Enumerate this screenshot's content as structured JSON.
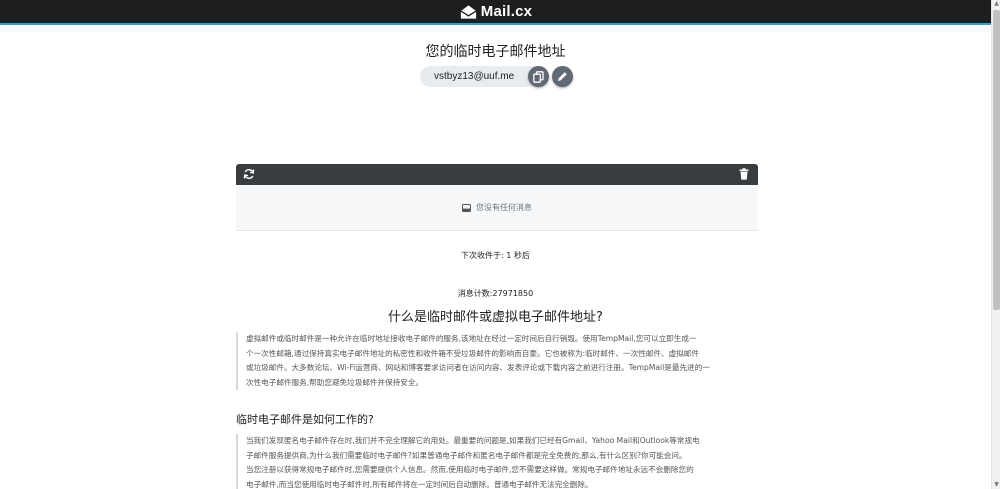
{
  "header": {
    "logo_text": "Mail.cx"
  },
  "address": {
    "title": "您的临时电子邮件地址",
    "email": "vstbyz13@uuf.me"
  },
  "inbox": {
    "empty_text": "您没有任何消息",
    "next_label": "下次收件于:",
    "next_value": "1",
    "next_unit": "秒后"
  },
  "stats": {
    "message_count": "消息计数:27971850"
  },
  "article": {
    "title": "什么是临时邮件或虚拟电子邮件地址?",
    "paragraph_lines": [
      "虚拟邮件或临时邮件是一种允许在临时地址接收电子邮件的服务,该地址在经过一定时间后自行销毁。使用TempMail,您可以立即生成一",
      "个一次性邮箱,通过保持真实电子邮件地址的私密性和收件箱不受垃圾邮件的影响而自豪。它也被称为:临时邮件、一次性邮件、虚拟邮件",
      "或垃圾邮件。大多数论坛、Wi-Fi运营商、网站和博客要求访问者在访问内容、发表评论或下载内容之前进行注册。TempMail是最先进的一",
      "次性电子邮件服务,帮助您避免垃圾邮件并保持安全。"
    ],
    "section_title": "临时电子邮件是如何工作的?",
    "section_lines": [
      "当我们发现匿名电子邮件存在时,我们并不完全理解它的用处。最重要的问题是,如果我们已经有Gmail、Yahoo Mail和Outlook等常规电",
      "子邮件服务提供商,为什么我们需要临时电子邮件?如果普通电子邮件和匿名电子邮件都是完全免费的,那么,有什么区别?你可能会问。",
      "当您注册以获得常规电子邮件时,您需要提供个人信息。然而,使用临时电子邮件,您不需要这样做。常规电子邮件地址永远不会删除您的",
      "电子邮件,而当您使用临时电子邮件时,所有邮件将在一定时间后自动删除。普通电子邮件无法完全删除。"
    ]
  },
  "colors": {
    "topbar": "#1d1e20",
    "accent": "#2f9fd3",
    "inbox_bar": "#3a3d40",
    "button": "#616a74"
  }
}
